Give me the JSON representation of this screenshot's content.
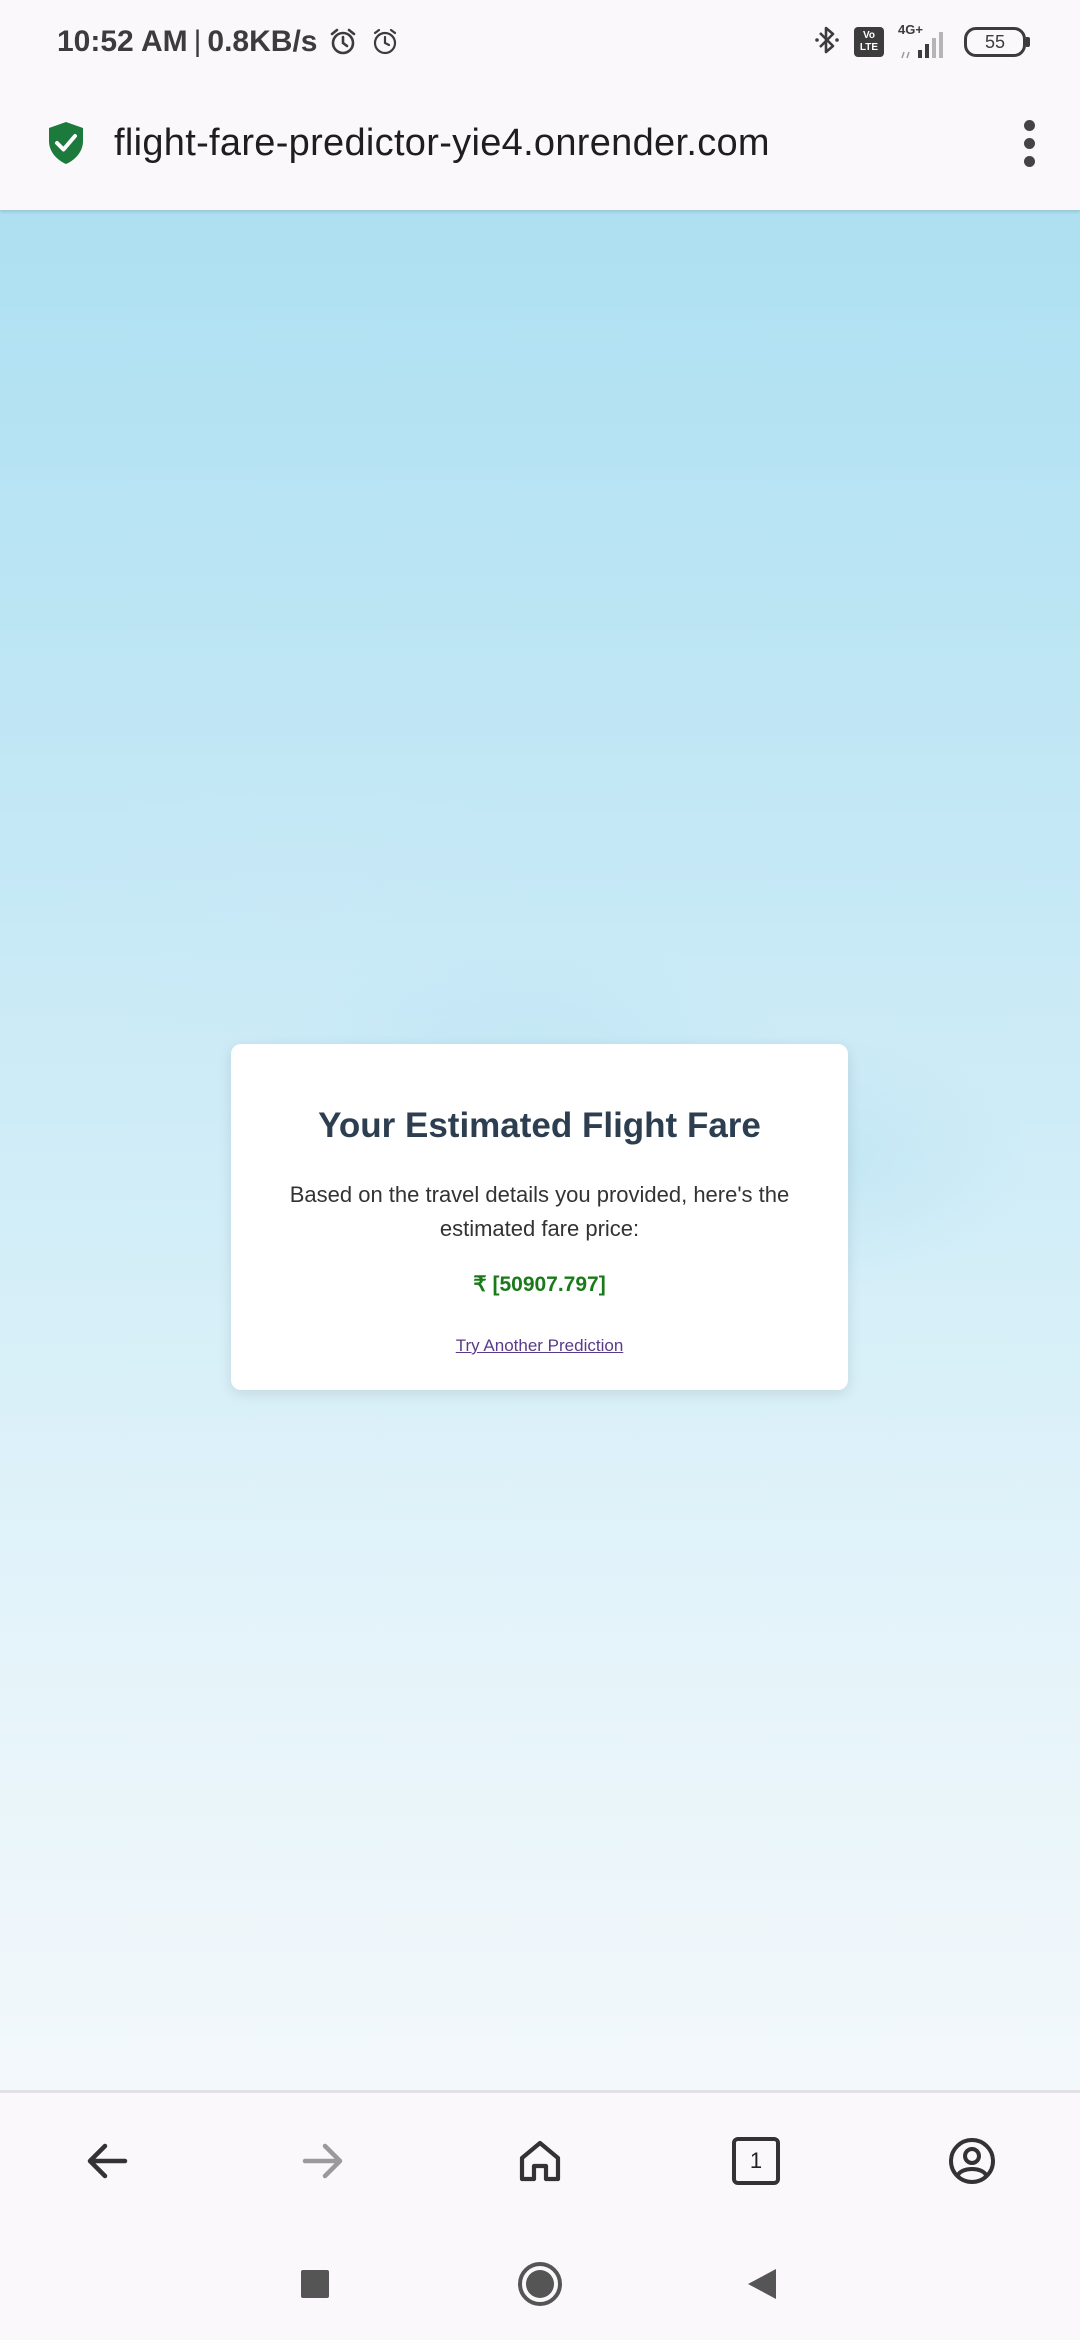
{
  "status_bar": {
    "time": "10:52 AM",
    "separator": "|",
    "speed": "0.8KB/s",
    "volte": "Vo LTE",
    "network": "4G+",
    "battery": "55"
  },
  "browser": {
    "url": "flight-fare-predictor-yie4.onrender.com",
    "menu_icon": "more-vert-icon",
    "secure_icon": "shield-check-icon",
    "tab_count": "1"
  },
  "card": {
    "title": "Your Estimated Flight Fare",
    "description": "Based on the travel details you provided, here's the estimated fare price:",
    "price": "₹ [50907.797]",
    "link": "Try Another Prediction"
  },
  "colors": {
    "price": "#1a7a1a",
    "title": "#2c3e50",
    "link": "#5a3a8a",
    "secure_shield": "#1b7a3c"
  }
}
